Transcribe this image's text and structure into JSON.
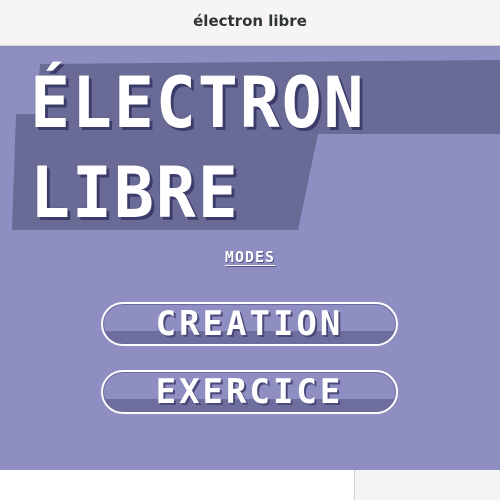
{
  "window": {
    "title": "électron libre"
  },
  "logo": {
    "line1": "ÉLECTRON",
    "line2": "LIBRE"
  },
  "menu": {
    "modes_label": "MODES",
    "buttons": [
      {
        "label": "CREATION"
      },
      {
        "label": "EXERCICE"
      }
    ]
  },
  "colors": {
    "background": "#8e8ec2",
    "banner": "#6a6a96",
    "text": "#ffffff",
    "titlebar": "#f6f5f4"
  }
}
